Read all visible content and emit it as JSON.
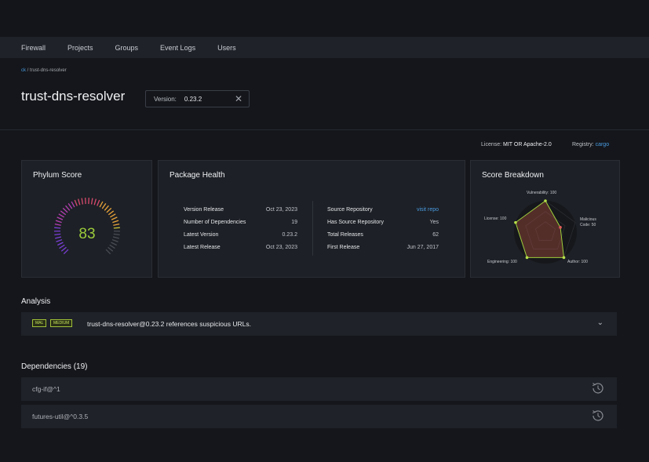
{
  "nav": {
    "items": [
      "Firewall",
      "Projects",
      "Groups",
      "Event Logs",
      "Users"
    ]
  },
  "breadcrumb": {
    "link": "ck",
    "separator": " / ",
    "current": "trust-dns-resolver"
  },
  "package": {
    "name": "trust-dns-resolver"
  },
  "version_select": {
    "label": "Version:",
    "value": "0.23.2",
    "clear_icon": "close-icon"
  },
  "meta": {
    "license_label": "License:",
    "license_value": "MIT OR Apache-2.0",
    "registry_label": "Registry:",
    "registry_value": "cargo"
  },
  "phylum_score": {
    "title": "Phylum Score",
    "value": "83",
    "level": 0.83
  },
  "health": {
    "title": "Package Health",
    "left": [
      {
        "label": "Version Release",
        "value": "Oct 23, 2023"
      },
      {
        "label": "Number of Dependencies",
        "value": "19"
      },
      {
        "label": "Latest Version",
        "value": "0.23.2"
      },
      {
        "label": "Latest Release",
        "value": "Oct 23, 2023"
      }
    ],
    "right": [
      {
        "label": "Source Repository",
        "value": "visit repo"
      },
      {
        "label": "Has Source Repository",
        "value": "Yes"
      },
      {
        "label": "Total Releases",
        "value": "62"
      },
      {
        "label": "First Release",
        "value": "Jun 27, 2017"
      }
    ]
  },
  "breakdown": {
    "title": "Score Breakdown",
    "labels": {
      "vulnerability": "Vulnerability: 100",
      "malicious_1": "Malicious",
      "malicious_2": "Code: 50",
      "author": "Author: 100",
      "engineering": "Engineering: 100",
      "license": "License: 100"
    },
    "scores": {
      "vulnerability": 100,
      "malicious": 50,
      "author": 100,
      "engineering": 100,
      "license": 100
    }
  },
  "analysis": {
    "title": "Analysis",
    "tags": [
      "MAL",
      "MEDIUM"
    ],
    "finding": "trust-dns-resolver@0.23.2 references suspicious URLs.",
    "expand_icon": "chevron-down-icon"
  },
  "dependencies": {
    "title": "Dependencies (19)",
    "items": [
      "cfg-if@^1",
      "futures-util@^0.3.5"
    ],
    "row_icon": "history-icon"
  },
  "colors": {
    "accent_link": "#4a9be0",
    "score_green": "#9ccc3b",
    "tag_green": "#c4e35a"
  }
}
